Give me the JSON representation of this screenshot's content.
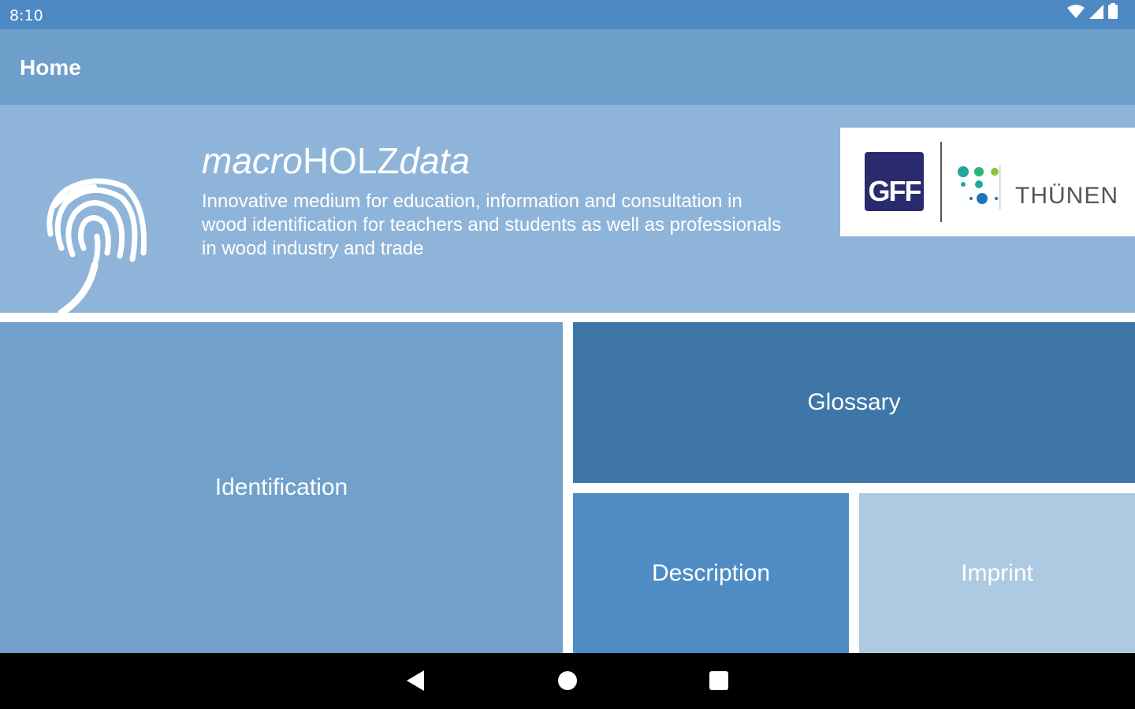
{
  "status_bar": {
    "time": "8:10",
    "icons": [
      "wifi-icon",
      "cellular-signal-icon",
      "battery-icon"
    ]
  },
  "app_bar": {
    "title": "Home"
  },
  "header": {
    "brand_italic_1": "macro",
    "brand_regular": "HOLZ",
    "brand_italic_2": "data",
    "tagline": "Innovative medium for education, information and consultation in wood identification for teachers and students as well as professionals in wood industry and trade",
    "logos": {
      "gff": "GFF",
      "thuenen": "THÜNEN"
    }
  },
  "tiles": {
    "identification": "Identification",
    "glossary": "Glossary",
    "description": "Description",
    "imprint": "Imprint"
  },
  "nav_bar": {
    "buttons": [
      "back-icon",
      "home-icon",
      "recents-icon"
    ]
  },
  "colors": {
    "status_bar": "#4d8ac4",
    "app_bar": "#6e9fcb",
    "header": "#8fb4d9",
    "identification": "#71a0cb",
    "glossary": "#3e76a8",
    "description": "#4f8cc4",
    "imprint": "#aecae3"
  }
}
